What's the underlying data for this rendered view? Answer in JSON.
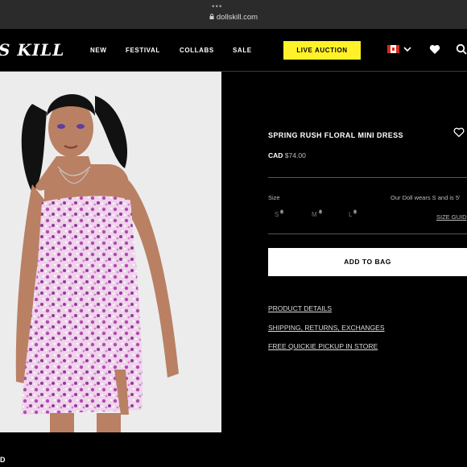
{
  "browser": {
    "dots": "•••",
    "url": "dollskill.com"
  },
  "nav": {
    "logo": "S KILL",
    "links": [
      "NEW",
      "FESTIVAL",
      "COLLABS",
      "SALE"
    ],
    "auction": "LIVE AUCTION",
    "flag": "canada-flag-icon"
  },
  "product": {
    "title": "SPRING RUSH FLORAL MINI DRESS",
    "currency": "CAD",
    "price": "$74.00",
    "size_label": "Size",
    "doll_note": "Our Doll wears S and is 5'",
    "sizes": [
      "S",
      "M",
      "L"
    ],
    "size_guide": "SIZE GUID",
    "add_to_bag": "ADD TO BAG",
    "links": [
      "PRODUCT DETAILS",
      "SHIPPING, RETURNS, EXCHANGES",
      "FREE QUICKIE PICKUP IN STORE"
    ]
  },
  "footer": {
    "partial": "D"
  },
  "colors": {
    "accent": "#fff22a",
    "background": "#000000",
    "dress": "#e7b6e4"
  }
}
